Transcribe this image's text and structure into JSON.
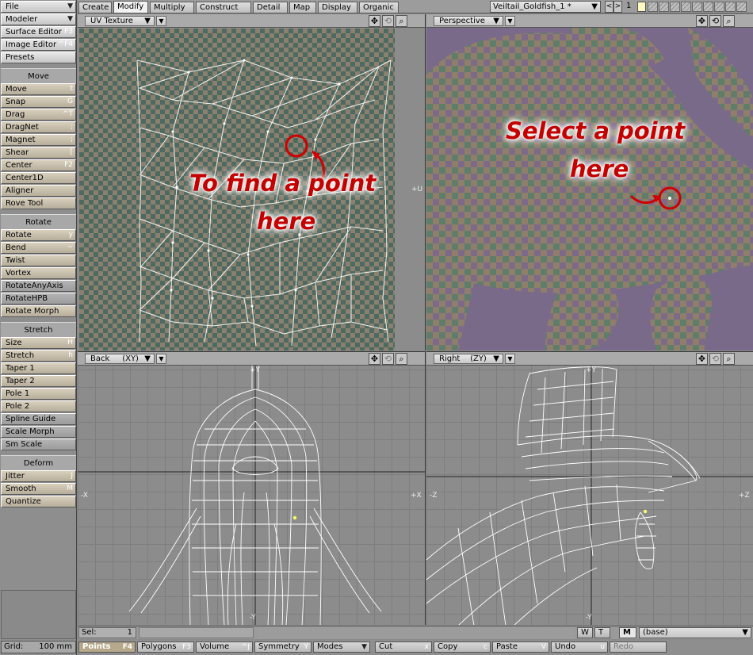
{
  "left_panel": {
    "file": "File",
    "modeler": "Modeler",
    "tools_top": [
      {
        "label": "Surface Editor",
        "shortcut": "F3"
      },
      {
        "label": "Image Editor",
        "shortcut": "^F4"
      },
      {
        "label": "Presets",
        "shortcut": ""
      }
    ],
    "move_header": "Move",
    "move_tools": [
      {
        "label": "Move",
        "shortcut": "t"
      },
      {
        "label": "Snap",
        "shortcut": "G"
      },
      {
        "label": "Drag",
        "shortcut": "^T"
      },
      {
        "label": "DragNet",
        "shortcut": ";"
      },
      {
        "label": "Magnet",
        "shortcut": ";"
      },
      {
        "label": "Shear",
        "shortcut": "["
      },
      {
        "label": "Center",
        "shortcut": "F2"
      },
      {
        "label": "Center1D",
        "shortcut": ""
      },
      {
        "label": "Aligner",
        "shortcut": ""
      },
      {
        "label": "Rove Tool",
        "shortcut": ""
      }
    ],
    "rotate_header": "Rotate",
    "rotate_tools": [
      {
        "label": "Rotate",
        "shortcut": "y"
      },
      {
        "label": "Bend",
        "shortcut": "~"
      },
      {
        "label": "Twist",
        "shortcut": ""
      },
      {
        "label": "Vortex",
        "shortcut": ""
      },
      {
        "label": "RotateAnyAxis",
        "shortcut": ""
      },
      {
        "label": "RotateHPB",
        "shortcut": ""
      },
      {
        "label": "Rotate Morph",
        "shortcut": ""
      }
    ],
    "stretch_header": "Stretch",
    "stretch_tools": [
      {
        "label": "Size",
        "shortcut": "H"
      },
      {
        "label": "Stretch",
        "shortcut": "h"
      },
      {
        "label": "Taper 1",
        "shortcut": ""
      },
      {
        "label": "Taper 2",
        "shortcut": ""
      },
      {
        "label": "Pole 1",
        "shortcut": ""
      },
      {
        "label": "Pole 2",
        "shortcut": ""
      },
      {
        "label": "Spline Guide",
        "shortcut": ""
      },
      {
        "label": "Scale Morph",
        "shortcut": ""
      },
      {
        "label": "Sm Scale",
        "shortcut": ""
      }
    ],
    "deform_header": "Deform",
    "deform_tools": [
      {
        "label": "Jitter",
        "shortcut": "J"
      },
      {
        "label": "Smooth",
        "shortcut": "M"
      },
      {
        "label": "Quantize",
        "shortcut": ""
      }
    ]
  },
  "tabs": [
    "Create",
    "Modify",
    "Multiply",
    "Construct",
    "Detail",
    "Map",
    "Display",
    "Organic"
  ],
  "active_tab": "Modify",
  "object_name": "Veiltail_Goldfish_1 *",
  "layer_number": "1",
  "viewports": {
    "tl": {
      "mode": "UV Texture",
      "axis": "+U"
    },
    "tr": {
      "mode": "Perspective"
    },
    "bl": {
      "mode": "Back",
      "view": "(XY)",
      "axis_top": "+Y",
      "axis_bottom": "-Y",
      "axis_left": "-X",
      "axis_right": "+X"
    },
    "br": {
      "mode": "Right",
      "view": "(ZY)",
      "axis_top": "+Y",
      "axis_bottom": "-Y",
      "axis_left": "-Z",
      "axis_right": "+Z"
    }
  },
  "annotations": {
    "left_line1": "To find a point",
    "left_line2": "here",
    "right_line1": "Select a point",
    "right_line2": "here"
  },
  "status": {
    "sel_label": "Sel:",
    "sel_value": "1",
    "w": "W",
    "t": "T",
    "m": "M",
    "layer": "(base)",
    "grid_label": "Grid:",
    "grid_value": "100 mm"
  },
  "bottom": {
    "points": "Points",
    "points_key": "F4",
    "polygons": "Polygons",
    "polygons_key": "F3",
    "volume": "Volume",
    "volume_key": "^J",
    "symmetry": "Symmetry",
    "symmetry_key": "Y",
    "modes": "Modes",
    "cut": "Cut",
    "cut_key": "x",
    "copy": "Copy",
    "copy_key": "c",
    "paste": "Paste",
    "paste_key": "V",
    "undo": "Undo",
    "undo_key": "u",
    "redo": "Redo"
  },
  "colors": {
    "annotation": "#c40000",
    "viewport_grey": "#8c8c8c",
    "persp_bg": "#7a6a8a",
    "wire": "#ffffff",
    "selected_point": "#ffff66"
  }
}
